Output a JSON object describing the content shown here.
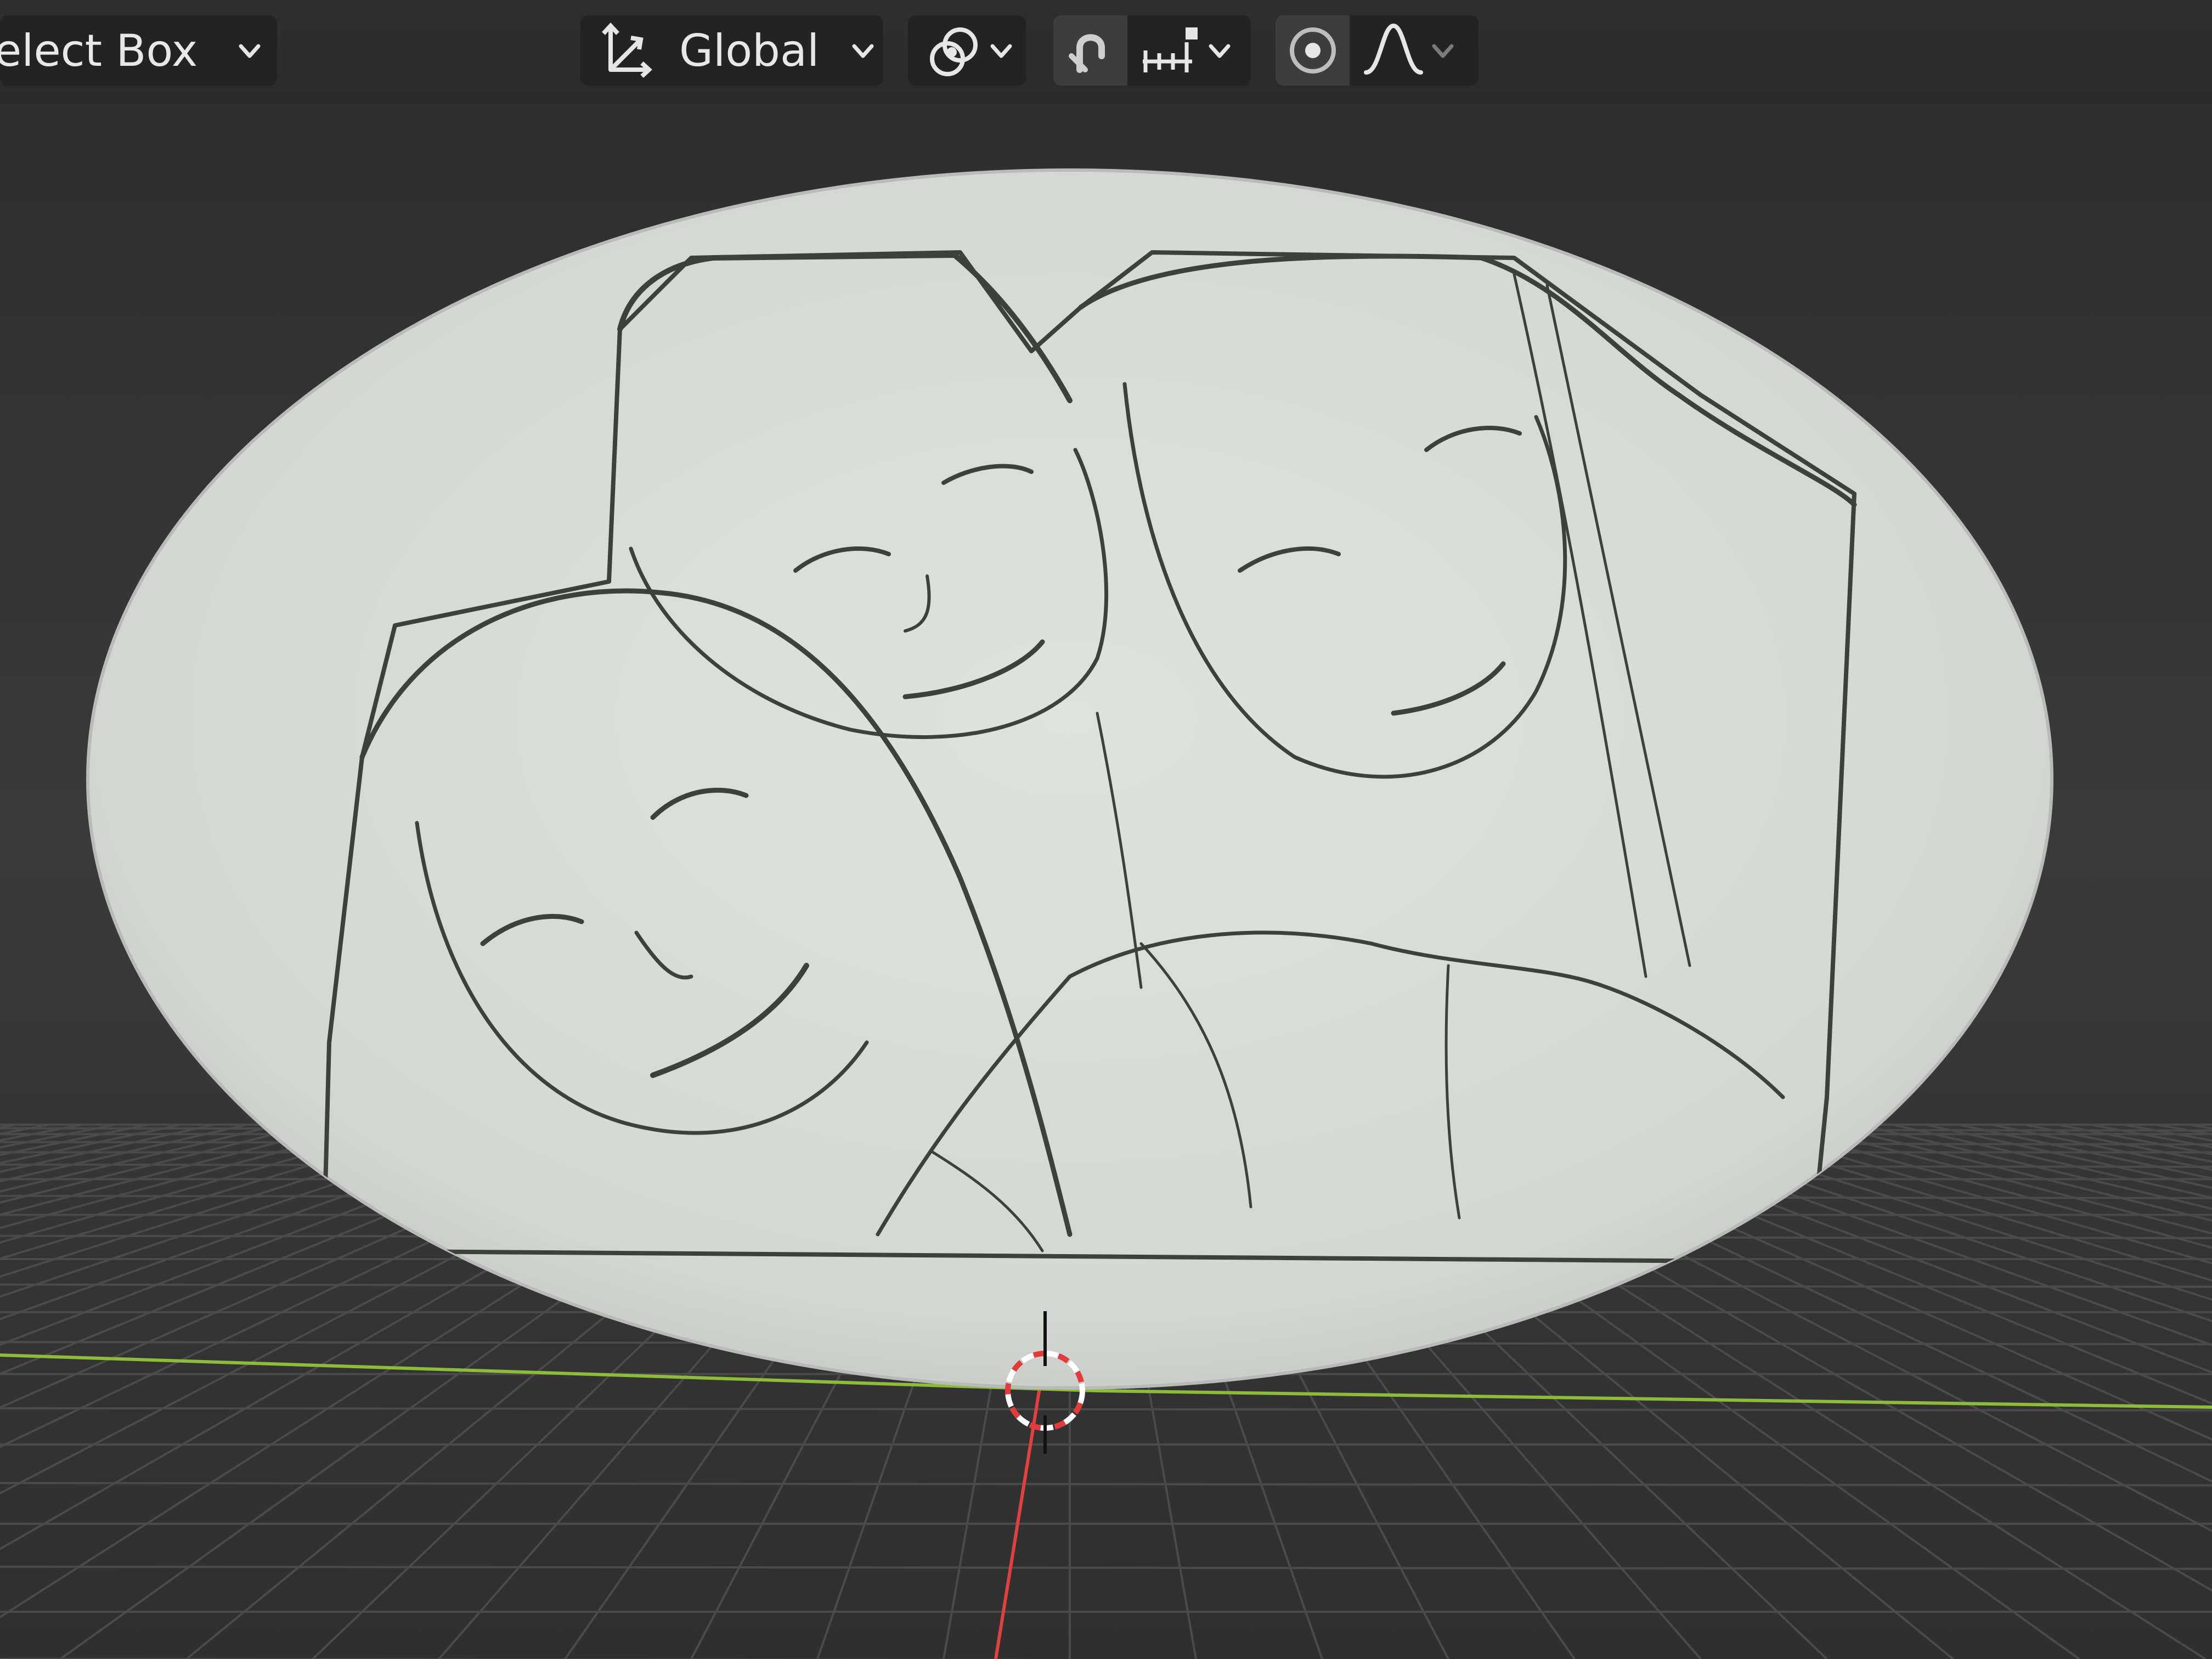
{
  "header": {
    "select_mode": {
      "label": "elect Box",
      "icon": "chevron-down-icon"
    },
    "orientation": {
      "label": "Global",
      "icon": "transform-orientation-icon"
    },
    "pivot": {
      "icon": "pivot-point-icon"
    },
    "snap": {
      "icon": "snap-magnet-icon",
      "increment_icon": "snap-increment-icon"
    },
    "proportional_editing": {
      "icon": "proportional-editing-icon",
      "falloff_icon": "falloff-curve-icon"
    }
  },
  "viewport": {
    "object": "oval-relief-plaque",
    "axis_colors": {
      "x": "#8dbb3a",
      "y": "#e04040"
    },
    "background": "#2e2e2e",
    "plaque_color": "#d9dcd9",
    "cursor_icon": "3d-cursor-icon"
  }
}
